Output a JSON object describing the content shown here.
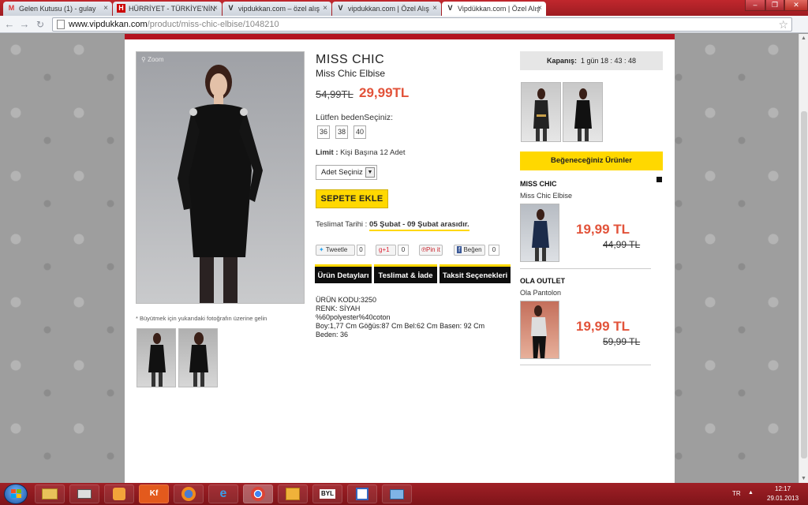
{
  "browser": {
    "tabs": [
      {
        "label": "Gelen Kutusu (1) - gulay",
        "icon": "gmail-icon",
        "fav_text": "M"
      },
      {
        "label": "HÜRRİYET - TÜRKİYE'NİN",
        "icon": "hurriyet-icon",
        "fav_text": "H"
      },
      {
        "label": "vipdukkan.com – özel alış",
        "icon": "vipdukkan-icon",
        "fav_text": "V"
      },
      {
        "label": "vipdukkan.com | Özel Alış",
        "icon": "vipdukkan-icon",
        "fav_text": "V"
      },
      {
        "label": "Vipdükkan.com | Özel Alış",
        "icon": "vipdukkan-icon",
        "fav_text": "V"
      }
    ],
    "url_host": "www.vipdukkan.com",
    "url_path": "/product/miss-chic-elbise/1048210"
  },
  "product": {
    "zoom_label": "Zoom",
    "zoom_caption": "* Büyütmek için yukarıdaki fotoğrafın üzerine gelin",
    "brand": "MISS CHIC",
    "name": "Miss Chic Elbise",
    "old_price": "54,99TL",
    "new_price": "29,99TL",
    "size_label": "Lütfen bedenSeçiniz:",
    "sizes": [
      "36",
      "38",
      "40"
    ],
    "limit_label": "Limit :",
    "limit_value": "Kişi Başına  12 Adet",
    "qty_placeholder": "Adet Seçiniz",
    "add_to_cart": "SEPETE EKLE",
    "delivery_label": "Teslimat Tarihi :",
    "delivery_dates": "05 Şubat - 09 Şubat arasıdır.",
    "social": [
      {
        "label": "Tweetle",
        "count": "0"
      },
      {
        "label": "+1",
        "count": "0"
      },
      {
        "label": "Pin it",
        "count": ""
      },
      {
        "label": "Beğen",
        "count": "0"
      }
    ],
    "tabs": [
      "Ürün Detayları",
      "Teslimat & İade",
      "Taksit Seçenekleri"
    ],
    "details": "ÜRÜN KODU:3250\nRENK: SİYAH\n%60polyester%40coton\nBoy:1,77 Cm Göğüs:87 Cm Bel:62 Cm Basen: 92 Cm\nBeden: 36"
  },
  "sidebar": {
    "countdown_label": "Kapanış:",
    "countdown_value": "1 gün 18 : 43 : 48",
    "rec_title": "Beğeneceğiniz Ürünler",
    "recs": [
      {
        "brand": "MISS CHIC",
        "name": "Miss Chic Elbise",
        "new_price": "19,99 TL",
        "old_price": "44,99 TL"
      },
      {
        "brand": "OLA OUTLET",
        "name": "Ola Pantolon",
        "new_price": "19,99 TL",
        "old_price": "59,99 TL"
      }
    ]
  },
  "taskbar": {
    "items": [
      "folder-icon",
      "network-icon",
      "media-player-icon",
      "kf-icon",
      "firefox-icon",
      "internet-explorer-icon",
      "chrome-icon",
      "outlook-icon",
      "byl-icon",
      "calendar-app-icon",
      "screen-app-icon"
    ],
    "kf_text": "Kf",
    "byl_text": "BYL",
    "lang": "TR",
    "time": "12:17",
    "date": "29.01.2013"
  },
  "colors": {
    "accent": "#ffd800",
    "price": "#e2533a",
    "brand_red": "#b3131f"
  }
}
